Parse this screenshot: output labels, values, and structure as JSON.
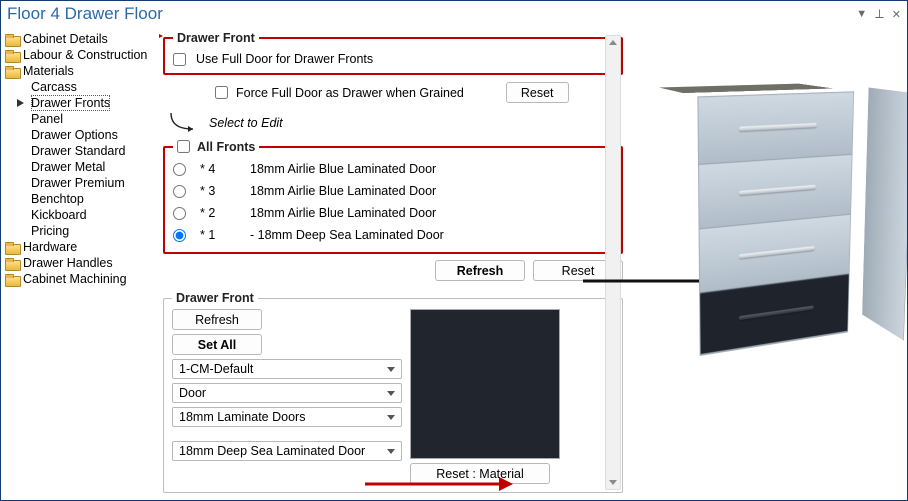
{
  "title": "Floor 4 Drawer Floor",
  "window_controls": {
    "dropdown": "▼",
    "pin": "⟂",
    "close": "✕"
  },
  "sidebar": {
    "top": [
      {
        "label": "Cabinet Details"
      },
      {
        "label": "Labour & Construction"
      },
      {
        "label": "Materials"
      }
    ],
    "materials_children": [
      "Carcass",
      "Drawer Fronts",
      "Panel",
      "Drawer Options",
      "Drawer Standard",
      "Drawer Metal",
      "Drawer Premium",
      "Benchtop",
      "Kickboard",
      "Pricing"
    ],
    "bottom": [
      {
        "label": "Hardware"
      },
      {
        "label": "Drawer Handles"
      },
      {
        "label": "Cabinet Machining"
      }
    ],
    "selected_child_index": 1
  },
  "drawer_front_group": {
    "legend": "Drawer Front",
    "use_full_door": "Use Full Door for Drawer Fronts",
    "force_full_door": "Force Full Door as Drawer when Grained",
    "reset": "Reset",
    "select_to_edit": "Select to Edit"
  },
  "all_fronts": {
    "legend": "All Fronts",
    "rows": [
      {
        "num": "* 4",
        "mat": "18mm Airlie Blue Laminated Door",
        "selected": false
      },
      {
        "num": "* 3",
        "mat": "18mm Airlie Blue Laminated Door",
        "selected": false
      },
      {
        "num": "* 2",
        "mat": "18mm Airlie Blue Laminated Door",
        "selected": false
      },
      {
        "num": "* 1",
        "mat": "- 18mm Deep Sea Laminated Door",
        "selected": true
      }
    ]
  },
  "buttons": {
    "refresh": "Refresh",
    "reset": "Reset",
    "set_all": "Set All",
    "reset_material": "Reset : Material"
  },
  "drawer_front_detail": {
    "legend": "Drawer Front",
    "dd1": "1-CM-Default",
    "dd2": "Door",
    "dd3": "18mm Laminate Doors",
    "dd4": "18mm Deep Sea Laminated Door"
  },
  "swatch_color": "#20252e"
}
